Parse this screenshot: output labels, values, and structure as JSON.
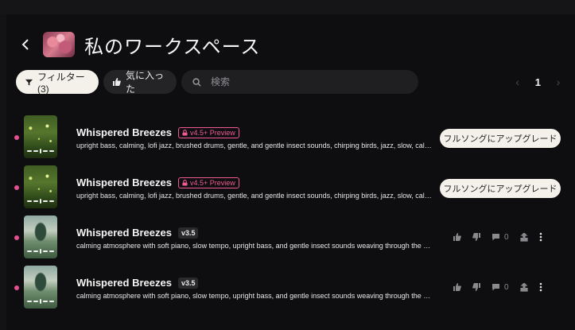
{
  "workspace": {
    "title": "私のワークスペース"
  },
  "toolbar": {
    "filter_label": "フィルター(3)",
    "favorites_label": "気に入った",
    "search_placeholder": "検索"
  },
  "pagination": {
    "current_page": "1"
  },
  "colors": {
    "accent_pink": "#ef5a92",
    "pill_light": "#f3f1e9",
    "bg": "#0e0e10"
  },
  "songs": [
    {
      "title": "Whispered Breezes",
      "badge": "v4.5+ Preview",
      "tags": "upright bass, calming, lofi jazz, brushed drums, gentle, and gentle insect sounds, chirping birds, jazz, slow, calming at...",
      "upgrade_label": "フルソングにアップグレード"
    },
    {
      "title": "Whispered Breezes",
      "badge": "v4.5+ Preview",
      "tags": "upright bass, calming, lofi jazz, brushed drums, gentle, and gentle insect sounds, chirping birds, jazz, slow, calming at...",
      "upgrade_label": "フルソングにアップグレード"
    },
    {
      "title": "Whispered Breezes",
      "badge": "v3.5",
      "tags": "calming atmosphere with soft piano, slow tempo, upright bass, and gentle insect sounds weaving through the melody, ...",
      "comment_count": "0"
    },
    {
      "title": "Whispered Breezes",
      "badge": "v3.5",
      "tags": "calming atmosphere with soft piano, slow tempo, upright bass, and gentle insect sounds weaving through the melody, ...",
      "comment_count": "0"
    }
  ]
}
